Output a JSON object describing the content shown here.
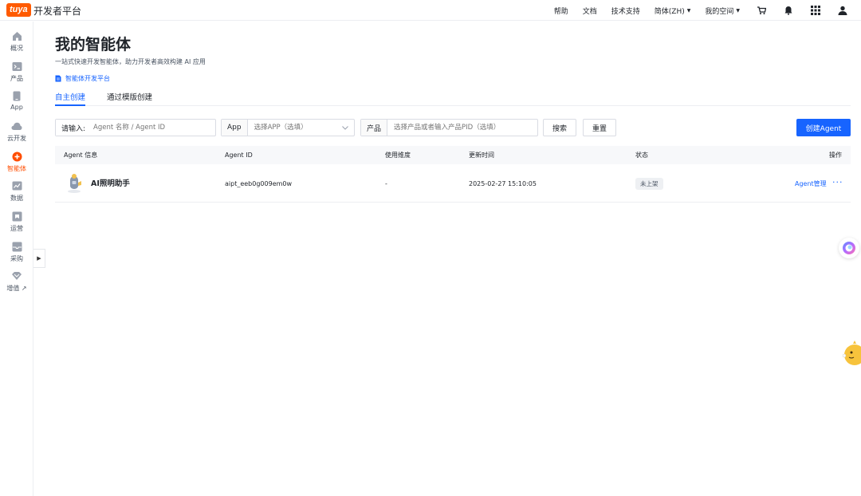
{
  "topbar": {
    "logo_text": "tuya",
    "brand": "开发者平台",
    "nav": [
      {
        "label": "帮助"
      },
      {
        "label": "文档"
      },
      {
        "label": "技术支持"
      },
      {
        "label": "简体(ZH)",
        "dropdown": true
      },
      {
        "label": "我的空间",
        "dropdown": true
      }
    ],
    "icons": [
      "cart-icon",
      "bell-icon",
      "apps-grid-icon",
      "user-icon"
    ]
  },
  "sidebar": {
    "items": [
      {
        "label": "概况",
        "icon": "home-icon"
      },
      {
        "label": "产品",
        "icon": "terminal-icon"
      },
      {
        "label": "App",
        "icon": "phone-icon"
      },
      {
        "label": "云开发",
        "icon": "cloud-icon"
      },
      {
        "label": "智能体",
        "icon": "agent-icon",
        "active": true
      },
      {
        "label": "数据",
        "icon": "chart-icon"
      },
      {
        "label": "运营",
        "icon": "operation-icon"
      },
      {
        "label": "采购",
        "icon": "purchase-icon"
      },
      {
        "label": "增值 ↗",
        "icon": "value-added-icon"
      }
    ]
  },
  "page": {
    "title": "我的智能体",
    "subtitle": "一站式快速开发智能体，助力开发者高效构建 AI 应用",
    "doc_link": "智能体开发平台"
  },
  "tabs": [
    {
      "label": "自主创建",
      "active": true
    },
    {
      "label": "通过模版创建",
      "active": false
    }
  ],
  "filters": {
    "search_label": "请输入:",
    "search_placeholder": "Agent 名称 / Agent ID",
    "app_label": "App",
    "app_placeholder": "选择APP（选填）",
    "product_label": "产品",
    "product_placeholder": "选择产品或者输入产品PID（选填）",
    "search_button": "搜索",
    "reset_button": "重置",
    "create_button": "创建Agent"
  },
  "table": {
    "columns": [
      "Agent 信息",
      "Agent ID",
      "使用维度",
      "更新时间",
      "状态",
      "操作"
    ],
    "rows": [
      {
        "name": "AI照明助手",
        "agent_id": "aipt_eeb0g009em0w",
        "dimension": "-",
        "updated": "2025-02-27 15:10:05",
        "status": "未上架",
        "action": "Agent管理",
        "more": "···"
      }
    ]
  },
  "colors": {
    "primary": "#1764ff",
    "brand_orange": "#ff5a00",
    "active_nav": "#ff4d00"
  }
}
